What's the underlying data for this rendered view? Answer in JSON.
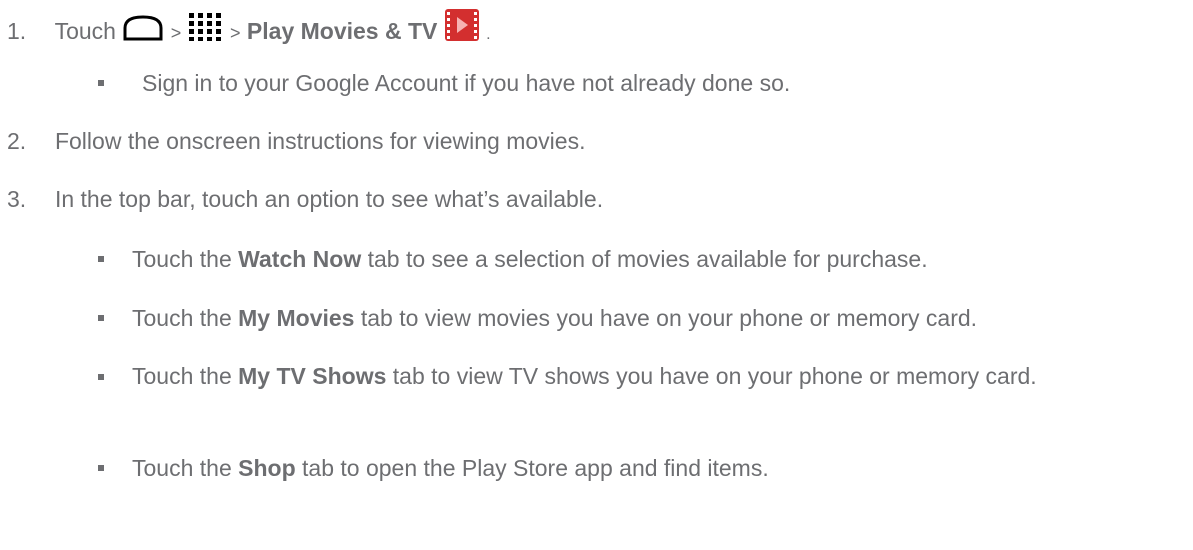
{
  "steps": [
    {
      "number": "1.",
      "parts": {
        "touch": "Touch",
        "sep1": ">",
        "sep2": ">",
        "app_name": "Play Movies & TV",
        "end": "."
      },
      "icons": [
        "home-icon",
        "apps-grid-icon",
        "play-movies-icon"
      ],
      "bullets": [
        {
          "text": "Sign in to your Google Account if you have not already done so."
        }
      ]
    },
    {
      "number": "2.",
      "text": "Follow the onscreen instructions for viewing movies."
    },
    {
      "number": "3.",
      "text": "In the top bar, touch an option to see what’s available.",
      "bullets": [
        {
          "pre": "Touch the",
          "bold": "Watch Now",
          "post": "tab to see a selection of movies available for purchase."
        },
        {
          "pre": "Touch the",
          "bold": "My Movies",
          "post": "tab to view movies you have on your phone or memory card."
        },
        {
          "pre": "Touch the",
          "bold": "My TV Shows",
          "post": "tab to view TV shows you have on your phone or memory card."
        },
        {
          "pre": "Touch the",
          "bold": "Shop",
          "post": "tab to open the Play Store app and find items."
        }
      ]
    }
  ],
  "colors": {
    "text": "#6d6e71",
    "icon_red": "#d32f2f"
  }
}
